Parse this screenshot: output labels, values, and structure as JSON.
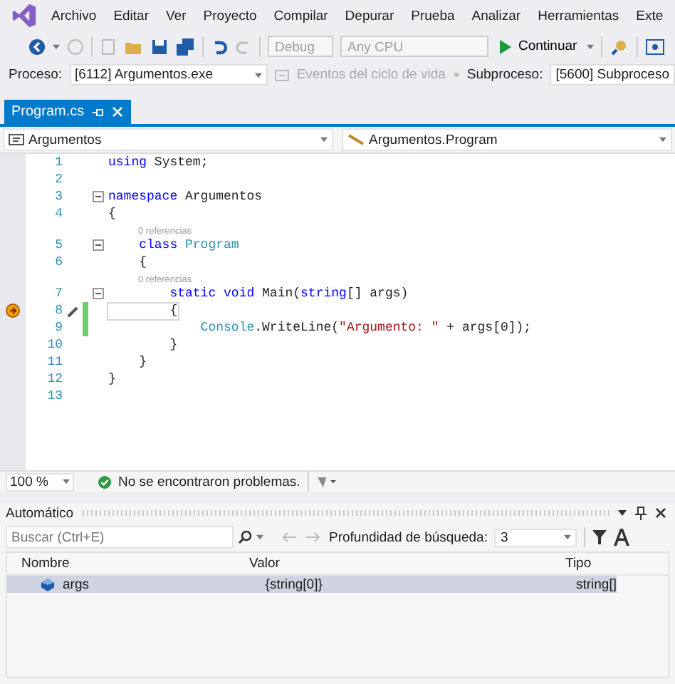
{
  "menu": [
    "Archivo",
    "Editar",
    "Ver",
    "Proyecto",
    "Compilar",
    "Depurar",
    "Prueba",
    "Analizar",
    "Herramientas",
    "Exte"
  ],
  "toolbar": {
    "configuration": {
      "value": "Debug",
      "disabled": true
    },
    "platform": {
      "value": "Any CPU",
      "disabled": true
    },
    "run": "Continuar"
  },
  "debug_location": {
    "process_label": "Proceso:",
    "process": "[6112] Argumentos.exe",
    "lifecycle": {
      "label": "Eventos del ciclo de vida",
      "disabled": true
    },
    "thread_label": "Subproceso:",
    "thread": "[5600] Subproceso"
  },
  "tabs": [
    {
      "label": "Program.cs",
      "selected": true
    }
  ],
  "navigation": {
    "project": "Argumentos",
    "type": "Argumentos.Program"
  },
  "code": {
    "lines": [
      {
        "number": "1",
        "tokens": [
          {
            "text": "using",
            "kind": "keyword"
          },
          {
            "text": " System;",
            "kind": "plain"
          }
        ]
      },
      {
        "number": "2"
      },
      {
        "number": "3",
        "foldable": true,
        "tokens": [
          {
            "text": "namespace",
            "kind": "keyword"
          },
          {
            "text": " Argumentos",
            "kind": "plain"
          }
        ]
      },
      {
        "number": "4",
        "tokens": [
          {
            "text": "{",
            "kind": "plain"
          }
        ]
      },
      {
        "number": "5",
        "foldable": true,
        "references": "0 referencias",
        "tokens": [
          {
            "text": "    class",
            "kind": "keyword"
          },
          {
            "text": " Program",
            "kind": "type"
          }
        ]
      },
      {
        "number": "6",
        "tokens": [
          {
            "text": "    {",
            "kind": "plain"
          }
        ]
      },
      {
        "number": "7",
        "foldable": true,
        "references": "0 referencias",
        "tokens": [
          {
            "text": "        static void",
            "kind": "keyword"
          },
          {
            "text": " Main(",
            "kind": "plain"
          },
          {
            "text": "string",
            "kind": "keyword"
          },
          {
            "text": "[] args)",
            "kind": "plain"
          }
        ]
      },
      {
        "number": "8",
        "current": true,
        "changed": true,
        "tokens": [
          {
            "text": "        {",
            "kind": "plain"
          }
        ]
      },
      {
        "number": "9",
        "changed": true,
        "tokens": [
          {
            "text": "            Console",
            "kind": "type"
          },
          {
            "text": ".WriteLine(",
            "kind": "plain"
          },
          {
            "text": "\"Argumento: \"",
            "kind": "string"
          },
          {
            "text": " + args[0]);",
            "kind": "plain"
          }
        ]
      },
      {
        "number": "10",
        "tokens": [
          {
            "text": "        }",
            "kind": "plain"
          }
        ]
      },
      {
        "number": "11",
        "tokens": [
          {
            "text": "    }",
            "kind": "plain"
          }
        ]
      },
      {
        "number": "12",
        "tokens": [
          {
            "text": "}",
            "kind": "plain"
          }
        ]
      },
      {
        "number": "13"
      }
    ]
  },
  "status": {
    "zoom": "100 %",
    "issues": "No se encontraron problemas."
  },
  "autos": {
    "title": "Automático",
    "search": {
      "placeholder": "Buscar (Ctrl+E)"
    },
    "depth_label": "Profundidad de búsqueda:",
    "depth": "3",
    "columns": [
      "Nombre",
      "Valor",
      "Tipo"
    ],
    "rows": [
      {
        "name": "args",
        "value": "{string[0]}",
        "type": "string[]",
        "selected": true
      }
    ]
  }
}
